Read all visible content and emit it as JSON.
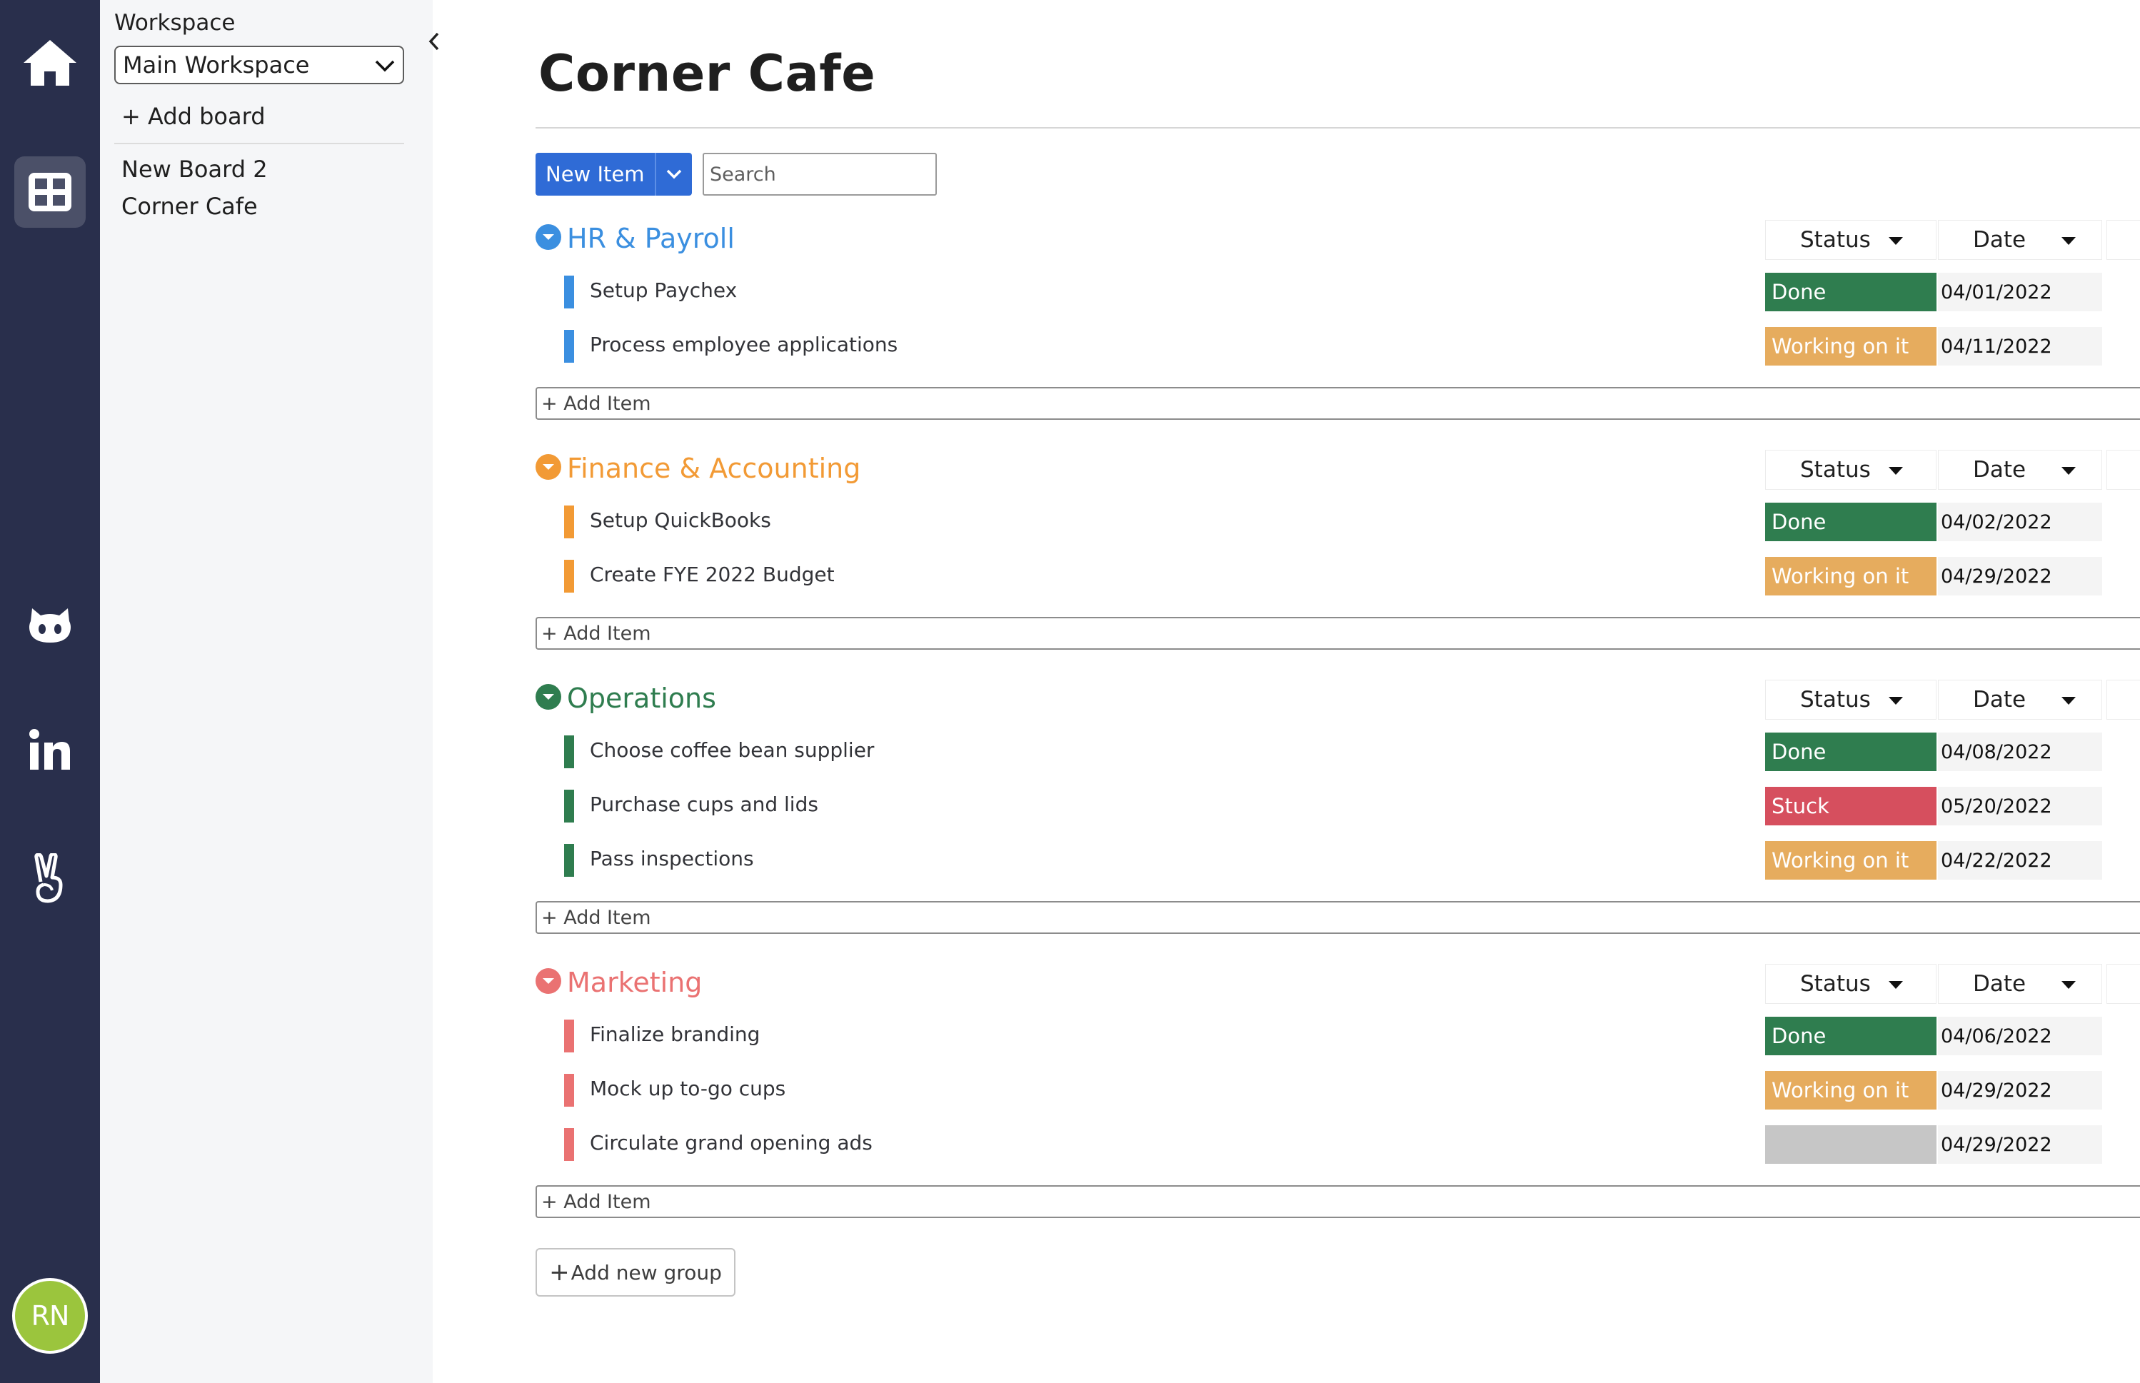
{
  "app": {
    "avatar_initials": "RN",
    "rail_icons": [
      "home-icon",
      "boards-icon",
      "github-icon",
      "linkedin-icon",
      "angellist-icon"
    ]
  },
  "sidebar": {
    "workspace_label": "Workspace",
    "workspace_selected": "Main Workspace",
    "add_board_label": "+ Add board",
    "boards": [
      "New Board 2",
      "Corner Cafe"
    ]
  },
  "board": {
    "title": "Corner Cafe",
    "new_item_label": "New Item",
    "search_placeholder": "Search",
    "add_group_label": "Add new group",
    "add_group_icon": "+"
  },
  "columns": {
    "status": "Status",
    "date": "Date"
  },
  "add_item_label": "+ Add Item",
  "status_colors": {
    "Done": "#2f7d4f",
    "Working on it": "#e6ac5e",
    "Stuck": "#d64f5e",
    "": "#c6c6c6"
  },
  "groups": [
    {
      "title": "HR & Payroll",
      "color": "#3b8fe0",
      "items": [
        {
          "name": "Setup Paychex",
          "status": "Done",
          "date": "04/01/2022"
        },
        {
          "name": "Process employee applications",
          "status": "Working on it",
          "date": "04/11/2022"
        }
      ]
    },
    {
      "title": "Finance & Accounting",
      "color": "#f29a35",
      "items": [
        {
          "name": "Setup QuickBooks",
          "status": "Done",
          "date": "04/02/2022"
        },
        {
          "name": "Create FYE 2022 Budget",
          "status": "Working on it",
          "date": "04/29/2022"
        }
      ]
    },
    {
      "title": "Operations",
      "color": "#2f7d4f",
      "items": [
        {
          "name": "Choose coffee bean supplier",
          "status": "Done",
          "date": "04/08/2022"
        },
        {
          "name": "Purchase cups and lids",
          "status": "Stuck",
          "date": "05/20/2022"
        },
        {
          "name": "Pass inspections",
          "status": "Working on it",
          "date": "04/22/2022"
        }
      ]
    },
    {
      "title": "Marketing",
      "color": "#ea7272",
      "items": [
        {
          "name": "Finalize branding",
          "status": "Done",
          "date": "04/06/2022"
        },
        {
          "name": "Mock up to-go cups",
          "status": "Working on it",
          "date": "04/29/2022"
        },
        {
          "name": "Circulate grand opening ads",
          "status": "",
          "date": "04/29/2022"
        }
      ]
    }
  ]
}
